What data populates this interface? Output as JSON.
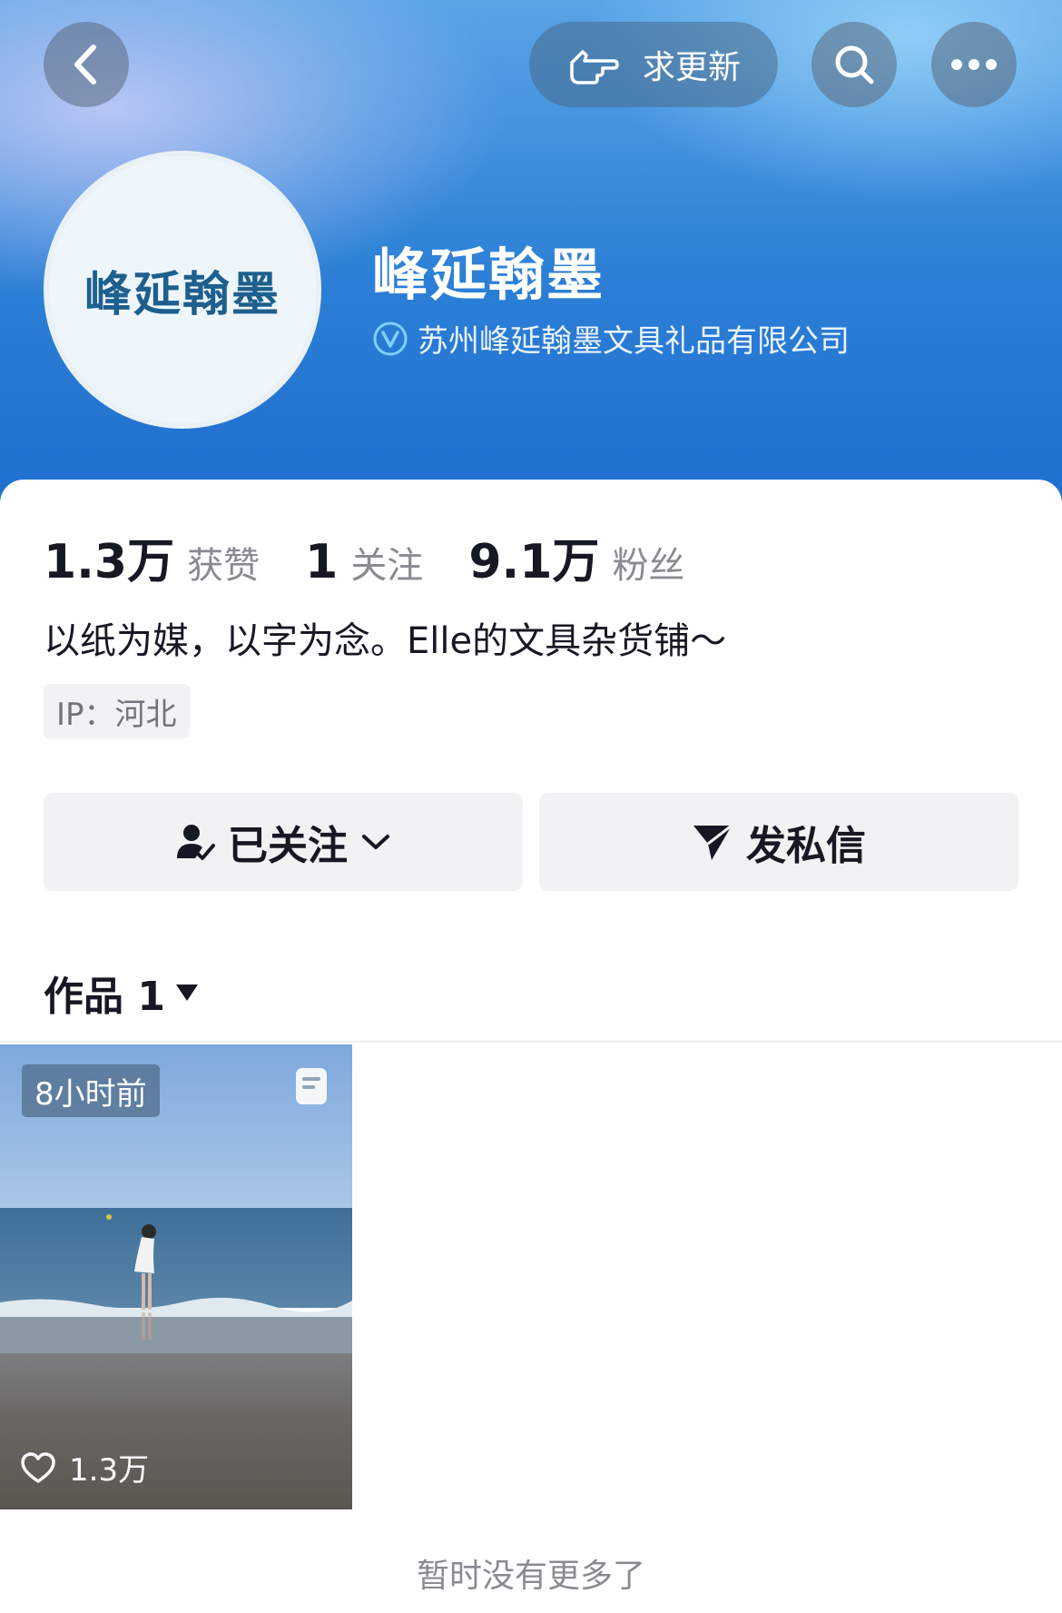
{
  "header": {
    "back_icon": "back-chevron-icon",
    "request_update_label": "求更新",
    "request_update_icon": "pointing-hand-icon",
    "search_icon": "search-icon",
    "more_icon": "more-dots-icon"
  },
  "profile": {
    "avatar_text": "峰延翰墨",
    "name": "峰延翰墨",
    "verified_icon": "verified-v-icon",
    "company": "苏州峰延翰墨文具礼品有限公司",
    "likes_count": "1.3万",
    "likes_label": "获赞",
    "following_count": "1",
    "following_label": "关注",
    "followers_count": "9.1万",
    "followers_label": "粉丝",
    "bio": "以纸为媒，以字为念。Elle的文具杂货铺～",
    "ip": "IP：河北"
  },
  "actions": {
    "followed_label": "已关注",
    "message_label": "发私信"
  },
  "works": {
    "tab_label": "作品 1",
    "items": [
      {
        "time_badge": "8小时前",
        "likes": "1.3万",
        "type_icon": "note-icon"
      }
    ],
    "no_more_text": "暂时没有更多了"
  },
  "colors": {
    "header_blue": "#2c7fd6",
    "button_gray": "#f2f2f4",
    "text_primary": "#161823",
    "text_secondary": "#8a8b91"
  }
}
